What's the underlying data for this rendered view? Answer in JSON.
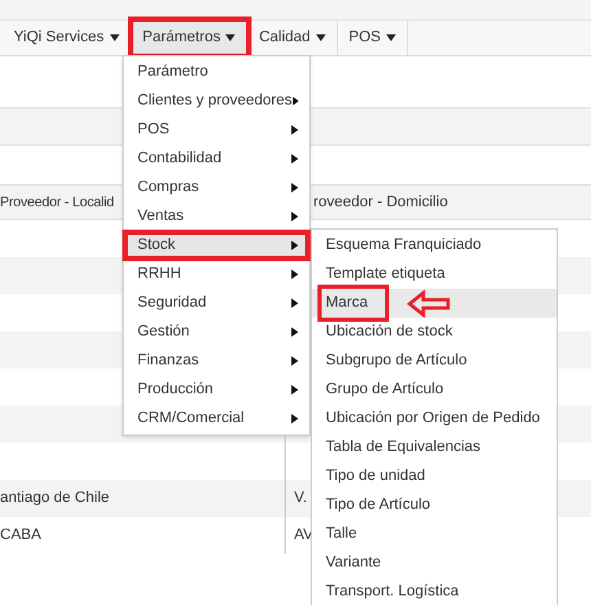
{
  "top_nav": [
    {
      "label": "YiQi Services",
      "selected": false,
      "annotated": false
    },
    {
      "label": "Parámetros",
      "selected": true,
      "annotated": true
    },
    {
      "label": "Calidad",
      "selected": false,
      "annotated": false
    },
    {
      "label": "POS",
      "selected": false,
      "annotated": false
    }
  ],
  "parametros_menu": {
    "items": [
      {
        "label": "Parámetro",
        "has_submenu": false,
        "selected": false,
        "annotated": false
      },
      {
        "label": "Clientes y proveedores",
        "has_submenu": true,
        "selected": false,
        "annotated": false
      },
      {
        "label": "POS",
        "has_submenu": true,
        "selected": false,
        "annotated": false
      },
      {
        "label": "Contabilidad",
        "has_submenu": true,
        "selected": false,
        "annotated": false
      },
      {
        "label": "Compras",
        "has_submenu": true,
        "selected": false,
        "annotated": false
      },
      {
        "label": "Ventas",
        "has_submenu": true,
        "selected": false,
        "annotated": false
      },
      {
        "label": "Stock",
        "has_submenu": true,
        "selected": true,
        "annotated": true
      },
      {
        "label": "RRHH",
        "has_submenu": true,
        "selected": false,
        "annotated": false
      },
      {
        "label": "Seguridad",
        "has_submenu": true,
        "selected": false,
        "annotated": false
      },
      {
        "label": "Gestión",
        "has_submenu": true,
        "selected": false,
        "annotated": false
      },
      {
        "label": "Finanzas",
        "has_submenu": true,
        "selected": false,
        "annotated": false
      },
      {
        "label": "Producción",
        "has_submenu": true,
        "selected": false,
        "annotated": false
      },
      {
        "label": "CRM/Comercial",
        "has_submenu": true,
        "selected": false,
        "annotated": false
      }
    ]
  },
  "stock_submenu": {
    "items": [
      {
        "label": "Esquema Franquiciado",
        "selected": false,
        "annotated": false
      },
      {
        "label": "Template etiqueta",
        "selected": false,
        "annotated": false
      },
      {
        "label": "Marca",
        "selected": true,
        "annotated": true
      },
      {
        "label": "Ubicación de stock",
        "selected": false,
        "annotated": false
      },
      {
        "label": "Subgrupo de Artículo",
        "selected": false,
        "annotated": false
      },
      {
        "label": "Grupo de Artículo",
        "selected": false,
        "annotated": false
      },
      {
        "label": "Ubicación por Origen de Pedido",
        "selected": false,
        "annotated": false
      },
      {
        "label": "Tabla de Equivalencias",
        "selected": false,
        "annotated": false
      },
      {
        "label": "Tipo de unidad",
        "selected": false,
        "annotated": false
      },
      {
        "label": "Tipo de Artículo",
        "selected": false,
        "annotated": false
      },
      {
        "label": "Talle",
        "selected": false,
        "annotated": false
      },
      {
        "label": "Variante",
        "selected": false,
        "annotated": false
      },
      {
        "label": "Transport. Logística",
        "selected": false,
        "annotated": false
      }
    ]
  },
  "table": {
    "columns": [
      "Proveedor - Localid",
      "roveedor - Domicilio"
    ],
    "rows": [
      [
        "antiago de Chile",
        "V."
      ],
      [
        "CABA",
        "AV"
      ]
    ]
  }
}
